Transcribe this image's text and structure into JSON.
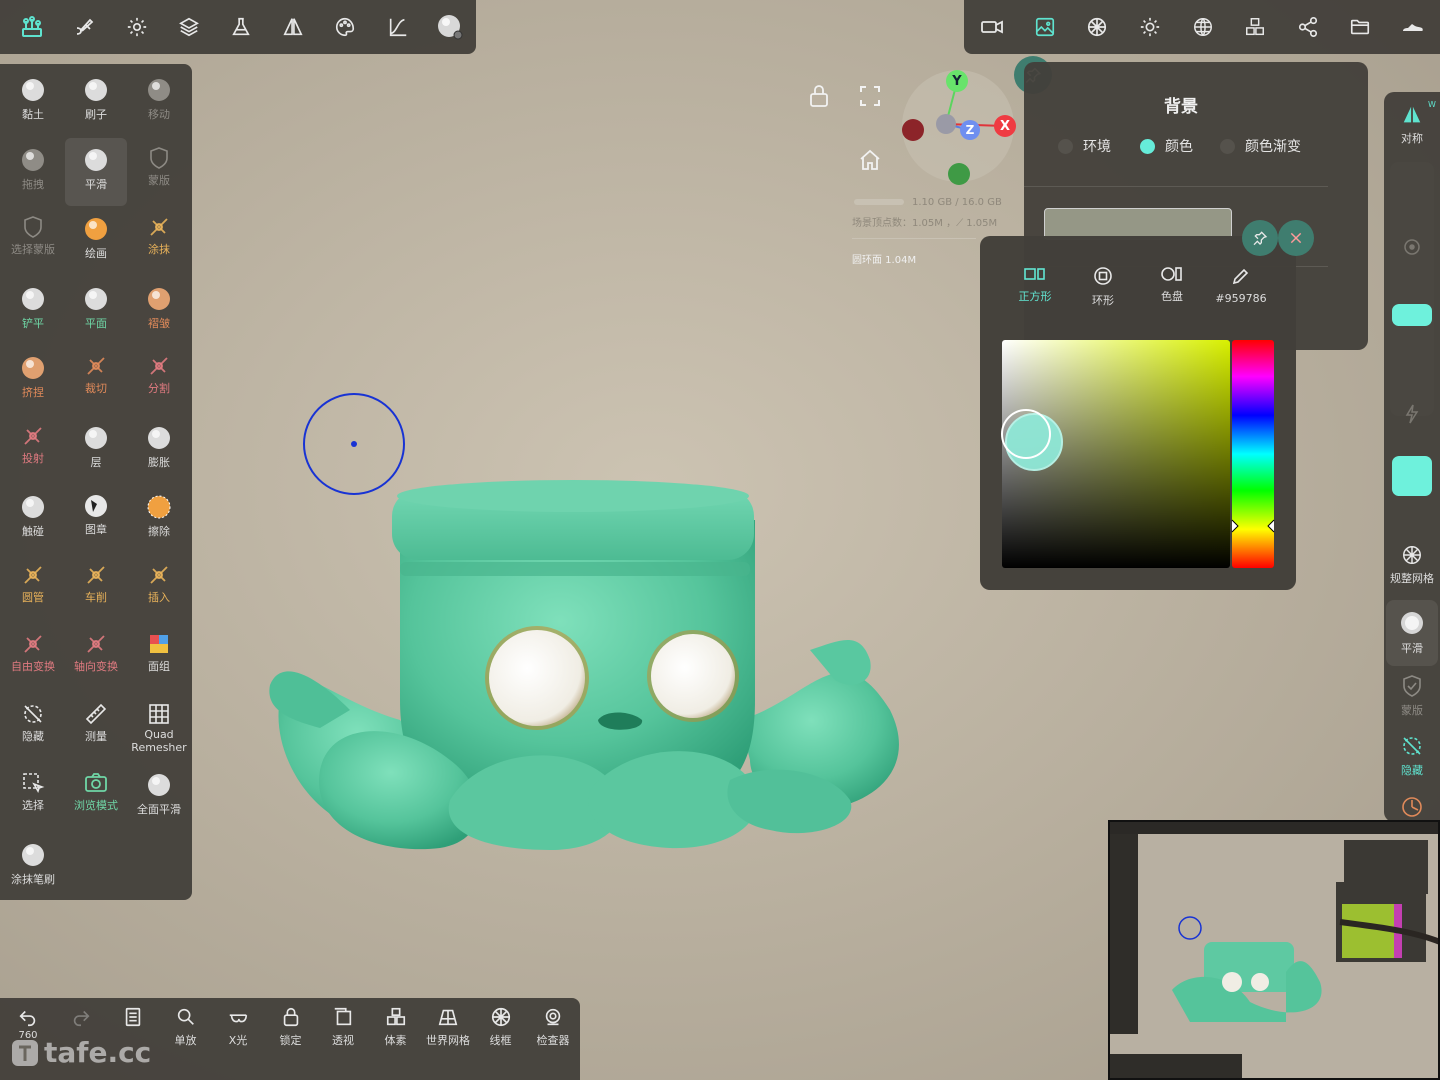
{
  "colors": {
    "accent": "#5fe3cf",
    "panel": "#423f3a",
    "model_green": "#5ec9a2",
    "background_selected": "#959786"
  },
  "top_left_icons": [
    "scene-tree-icon",
    "brush-settings-icon",
    "gear-icon",
    "layers-icon",
    "flask-icon",
    "symmetry-icon",
    "palette-icon",
    "curve-icon",
    "sphere-brush-icon"
  ],
  "top_right_icons": [
    "camera-icon",
    "image-icon",
    "material-icon",
    "sun-icon",
    "globe-icon",
    "cubes-icon",
    "share-icon",
    "folder-icon",
    "shoe-icon"
  ],
  "tools": [
    {
      "label": "黏土",
      "icon": "clay-sphere-icon",
      "style": "w"
    },
    {
      "label": "刷子",
      "icon": "brush-sphere-icon",
      "style": "w"
    },
    {
      "label": "移动",
      "icon": "move-sphere-icon",
      "style": "d"
    },
    {
      "label": "拖拽",
      "icon": "drag-sphere-icon",
      "style": "d"
    },
    {
      "label": "平滑",
      "icon": "smooth-sphere-icon",
      "style": "w",
      "active": true
    },
    {
      "label": "蒙版",
      "icon": "mask-shield-icon",
      "style": "d"
    },
    {
      "label": "选择蒙版",
      "icon": "select-mask-icon",
      "style": "d"
    },
    {
      "label": "绘画",
      "icon": "paint-sphere-icon",
      "style": "w"
    },
    {
      "label": "涂抹",
      "icon": "smudge-icon",
      "style": "y"
    },
    {
      "label": "铲平",
      "icon": "flatten-icon",
      "style": "g"
    },
    {
      "label": "平面",
      "icon": "plane-icon",
      "style": "g"
    },
    {
      "label": "褶皱",
      "icon": "crease-icon",
      "style": "o"
    },
    {
      "label": "挤捏",
      "icon": "pinch-icon",
      "style": "o"
    },
    {
      "label": "裁切",
      "icon": "trim-icon",
      "style": "o"
    },
    {
      "label": "分割",
      "icon": "split-icon",
      "style": "r"
    },
    {
      "label": "投射",
      "icon": "project-icon",
      "style": "r"
    },
    {
      "label": "层",
      "icon": "layer-sphere-icon",
      "style": "w"
    },
    {
      "label": "膨胀",
      "icon": "inflate-icon",
      "style": "w"
    },
    {
      "label": "触碰",
      "icon": "tap-icon",
      "style": "w"
    },
    {
      "label": "图章",
      "icon": "stamp-icon",
      "style": "w"
    },
    {
      "label": "擦除",
      "icon": "erase-icon",
      "style": "w"
    },
    {
      "label": "圆管",
      "icon": "tube-icon",
      "style": "y"
    },
    {
      "label": "车削",
      "icon": "lathe-icon",
      "style": "y"
    },
    {
      "label": "插入",
      "icon": "insert-icon",
      "style": "y"
    },
    {
      "label": "自由变换",
      "icon": "free-transform-icon",
      "style": "r"
    },
    {
      "label": "轴向变换",
      "icon": "axis-transform-icon",
      "style": "r"
    },
    {
      "label": "面组",
      "icon": "facegroup-icon",
      "style": "w"
    },
    {
      "label": "隐藏",
      "icon": "hide-icon",
      "style": "w"
    },
    {
      "label": "测量",
      "icon": "ruler-icon",
      "style": "w"
    },
    {
      "label": "Quad Remesher",
      "icon": "grid-icon",
      "style": "w"
    },
    {
      "label": "选择",
      "icon": "select-icon",
      "style": "w"
    },
    {
      "label": "浏览模式",
      "icon": "view-mode-icon",
      "style": "g"
    },
    {
      "label": "全面平滑",
      "icon": "global-smooth-icon",
      "style": "w"
    },
    {
      "label": "涂抹笔刷",
      "icon": "smudge-brush-icon",
      "style": "w"
    }
  ],
  "bottom_bar": [
    {
      "label": "",
      "icon": "undo-icon"
    },
    {
      "label": "",
      "icon": "redo-icon"
    },
    {
      "label": "",
      "icon": "document-icon"
    },
    {
      "label": "单放",
      "icon": "search-icon"
    },
    {
      "label": "X光",
      "icon": "xray-icon"
    },
    {
      "label": "锁定",
      "icon": "lock-icon"
    },
    {
      "label": "透视",
      "icon": "perspective-icon"
    },
    {
      "label": "体素",
      "icon": "voxel-icon"
    },
    {
      "label": "世界网格",
      "icon": "world-grid-icon"
    },
    {
      "label": "线框",
      "icon": "wireframe-icon"
    },
    {
      "label": "检查器",
      "icon": "inspector-icon"
    }
  ],
  "undo_count": "760",
  "stats": {
    "memory": "1.10 GB / 16.0 GB",
    "vertices": "场景顶点数：1.05M ，⟋ 1.05M",
    "mesh": "圆环面 1.04M"
  },
  "gizmo": {
    "y": "Y",
    "z": "Z",
    "x": "X"
  },
  "background_panel": {
    "title": "背景",
    "options": [
      {
        "label": "环境",
        "selected": false
      },
      {
        "label": "颜色",
        "selected": true
      },
      {
        "label": "颜色渐变",
        "selected": false
      }
    ]
  },
  "color_picker": {
    "tabs": [
      {
        "label": "正方形",
        "icon": "square-picker-icon",
        "active": true
      },
      {
        "label": "环形",
        "icon": "ring-picker-icon",
        "active": false
      },
      {
        "label": "色盘",
        "icon": "disc-picker-icon",
        "active": false
      },
      {
        "label": "#959786",
        "icon": "pencil-icon",
        "active": false
      }
    ]
  },
  "right_column": {
    "symmetry": {
      "label": "对称",
      "badge": "W"
    },
    "remesh": "规整网格",
    "smooth": "平滑",
    "mask": "蒙版",
    "hide": "隐藏"
  },
  "watermark": "tafe.cc"
}
